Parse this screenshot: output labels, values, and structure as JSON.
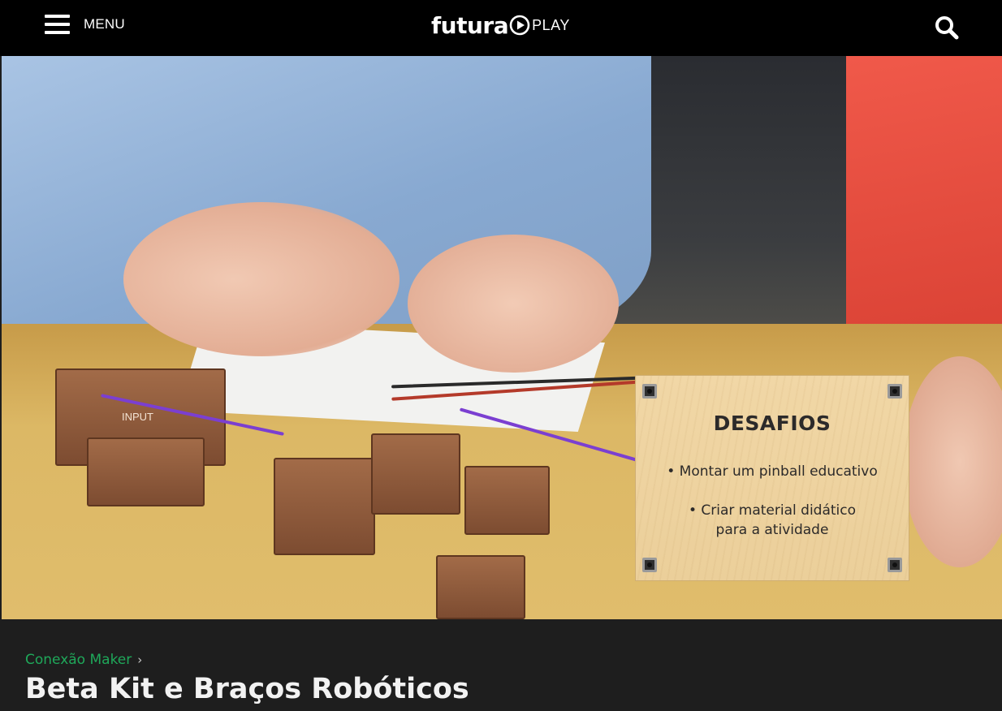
{
  "header": {
    "menu_label": "MENU",
    "logo_primary": "futura",
    "logo_secondary": "PLAY"
  },
  "video": {
    "overlay": {
      "title": "DESAFIOS",
      "items": [
        "• Montar um pinball educativo",
        "• Criar material didático",
        "para a atividade"
      ]
    },
    "block_label": "INPUT"
  },
  "info": {
    "breadcrumb": "Conexão Maker",
    "title": "Beta Kit e Braços Robóticos"
  },
  "colors": {
    "accent": "#1fa85a",
    "topbar": "#000000",
    "background": "#1e1e1e"
  }
}
